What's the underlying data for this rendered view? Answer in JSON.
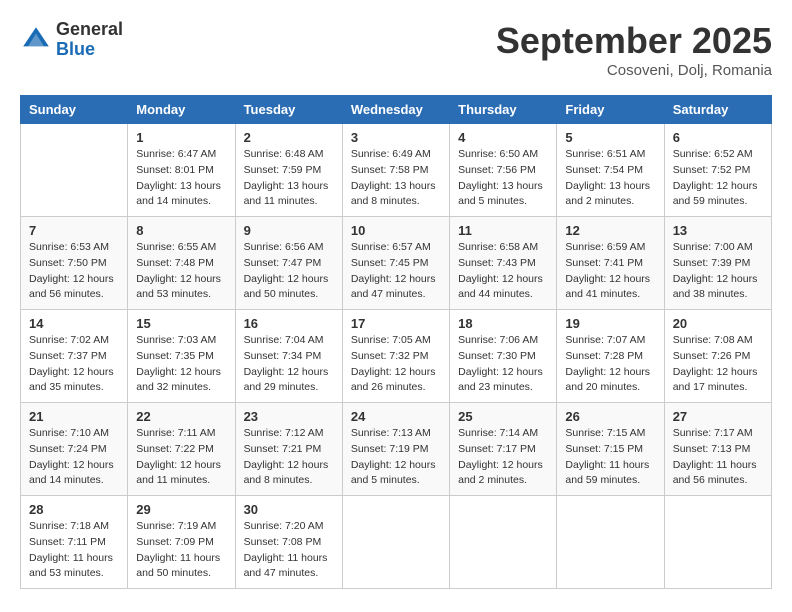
{
  "header": {
    "logo_general": "General",
    "logo_blue": "Blue",
    "month": "September 2025",
    "location": "Cosoveni, Dolj, Romania"
  },
  "days_of_week": [
    "Sunday",
    "Monday",
    "Tuesday",
    "Wednesday",
    "Thursday",
    "Friday",
    "Saturday"
  ],
  "weeks": [
    [
      {
        "day": "",
        "info": ""
      },
      {
        "day": "1",
        "info": "Sunrise: 6:47 AM\nSunset: 8:01 PM\nDaylight: 13 hours\nand 14 minutes."
      },
      {
        "day": "2",
        "info": "Sunrise: 6:48 AM\nSunset: 7:59 PM\nDaylight: 13 hours\nand 11 minutes."
      },
      {
        "day": "3",
        "info": "Sunrise: 6:49 AM\nSunset: 7:58 PM\nDaylight: 13 hours\nand 8 minutes."
      },
      {
        "day": "4",
        "info": "Sunrise: 6:50 AM\nSunset: 7:56 PM\nDaylight: 13 hours\nand 5 minutes."
      },
      {
        "day": "5",
        "info": "Sunrise: 6:51 AM\nSunset: 7:54 PM\nDaylight: 13 hours\nand 2 minutes."
      },
      {
        "day": "6",
        "info": "Sunrise: 6:52 AM\nSunset: 7:52 PM\nDaylight: 12 hours\nand 59 minutes."
      }
    ],
    [
      {
        "day": "7",
        "info": "Sunrise: 6:53 AM\nSunset: 7:50 PM\nDaylight: 12 hours\nand 56 minutes."
      },
      {
        "day": "8",
        "info": "Sunrise: 6:55 AM\nSunset: 7:48 PM\nDaylight: 12 hours\nand 53 minutes."
      },
      {
        "day": "9",
        "info": "Sunrise: 6:56 AM\nSunset: 7:47 PM\nDaylight: 12 hours\nand 50 minutes."
      },
      {
        "day": "10",
        "info": "Sunrise: 6:57 AM\nSunset: 7:45 PM\nDaylight: 12 hours\nand 47 minutes."
      },
      {
        "day": "11",
        "info": "Sunrise: 6:58 AM\nSunset: 7:43 PM\nDaylight: 12 hours\nand 44 minutes."
      },
      {
        "day": "12",
        "info": "Sunrise: 6:59 AM\nSunset: 7:41 PM\nDaylight: 12 hours\nand 41 minutes."
      },
      {
        "day": "13",
        "info": "Sunrise: 7:00 AM\nSunset: 7:39 PM\nDaylight: 12 hours\nand 38 minutes."
      }
    ],
    [
      {
        "day": "14",
        "info": "Sunrise: 7:02 AM\nSunset: 7:37 PM\nDaylight: 12 hours\nand 35 minutes."
      },
      {
        "day": "15",
        "info": "Sunrise: 7:03 AM\nSunset: 7:35 PM\nDaylight: 12 hours\nand 32 minutes."
      },
      {
        "day": "16",
        "info": "Sunrise: 7:04 AM\nSunset: 7:34 PM\nDaylight: 12 hours\nand 29 minutes."
      },
      {
        "day": "17",
        "info": "Sunrise: 7:05 AM\nSunset: 7:32 PM\nDaylight: 12 hours\nand 26 minutes."
      },
      {
        "day": "18",
        "info": "Sunrise: 7:06 AM\nSunset: 7:30 PM\nDaylight: 12 hours\nand 23 minutes."
      },
      {
        "day": "19",
        "info": "Sunrise: 7:07 AM\nSunset: 7:28 PM\nDaylight: 12 hours\nand 20 minutes."
      },
      {
        "day": "20",
        "info": "Sunrise: 7:08 AM\nSunset: 7:26 PM\nDaylight: 12 hours\nand 17 minutes."
      }
    ],
    [
      {
        "day": "21",
        "info": "Sunrise: 7:10 AM\nSunset: 7:24 PM\nDaylight: 12 hours\nand 14 minutes."
      },
      {
        "day": "22",
        "info": "Sunrise: 7:11 AM\nSunset: 7:22 PM\nDaylight: 12 hours\nand 11 minutes."
      },
      {
        "day": "23",
        "info": "Sunrise: 7:12 AM\nSunset: 7:21 PM\nDaylight: 12 hours\nand 8 minutes."
      },
      {
        "day": "24",
        "info": "Sunrise: 7:13 AM\nSunset: 7:19 PM\nDaylight: 12 hours\nand 5 minutes."
      },
      {
        "day": "25",
        "info": "Sunrise: 7:14 AM\nSunset: 7:17 PM\nDaylight: 12 hours\nand 2 minutes."
      },
      {
        "day": "26",
        "info": "Sunrise: 7:15 AM\nSunset: 7:15 PM\nDaylight: 11 hours\nand 59 minutes."
      },
      {
        "day": "27",
        "info": "Sunrise: 7:17 AM\nSunset: 7:13 PM\nDaylight: 11 hours\nand 56 minutes."
      }
    ],
    [
      {
        "day": "28",
        "info": "Sunrise: 7:18 AM\nSunset: 7:11 PM\nDaylight: 11 hours\nand 53 minutes."
      },
      {
        "day": "29",
        "info": "Sunrise: 7:19 AM\nSunset: 7:09 PM\nDaylight: 11 hours\nand 50 minutes."
      },
      {
        "day": "30",
        "info": "Sunrise: 7:20 AM\nSunset: 7:08 PM\nDaylight: 11 hours\nand 47 minutes."
      },
      {
        "day": "",
        "info": ""
      },
      {
        "day": "",
        "info": ""
      },
      {
        "day": "",
        "info": ""
      },
      {
        "day": "",
        "info": ""
      }
    ]
  ]
}
